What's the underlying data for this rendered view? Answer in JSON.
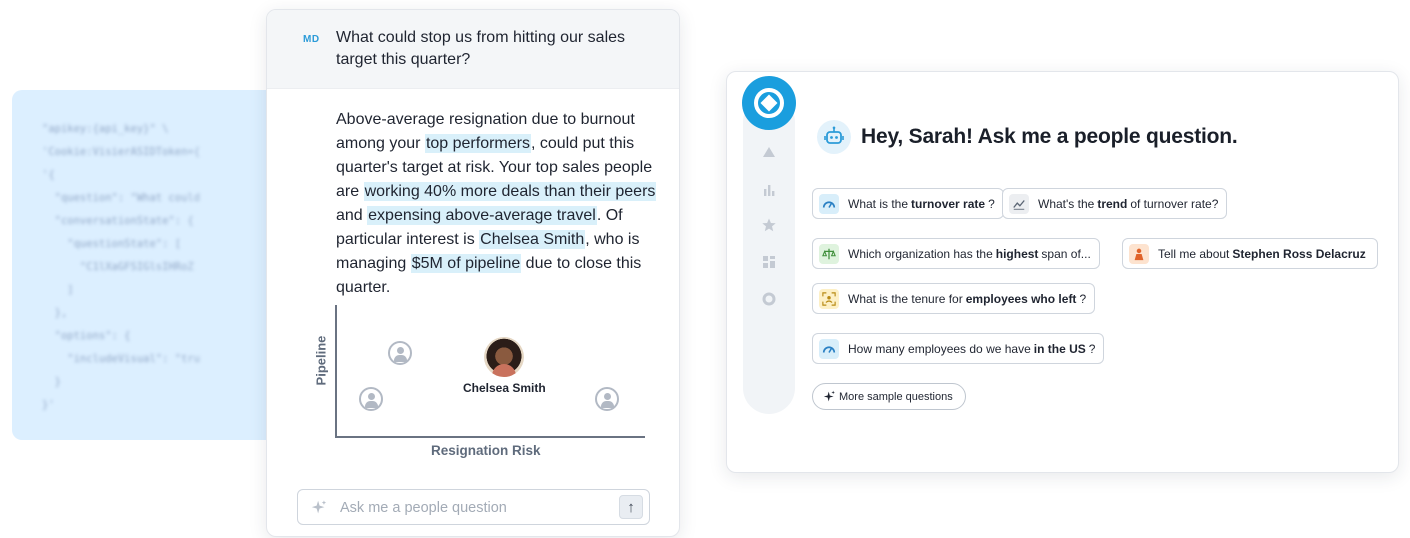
{
  "code_snippet": {
    "lines": [
      "\"apikey:{api_key}\" \\",
      "'Cookie:VisierASIDToken={",
      "'{",
      "  \"question\": \"What could",
      "  \"conversationState\": {",
      "    \"questionState\": [",
      "      \"C1lXaGFSIGlsIHRoZ",
      "    ]",
      "  },",
      "  \"options\": {",
      "    \"includeVisual\": \"tru",
      "  }",
      "}'"
    ]
  },
  "chat": {
    "user_initials": "MD",
    "question": "What could stop us from hitting our sales target this quarter?",
    "answer": {
      "p1": "Above-average resignation due to burnout among your ",
      "h1": "top performers",
      "p2": ", could put this quarter's target at risk. Your top sales people are ",
      "h2": "working 40% more deals than their peers",
      "p3": " and ",
      "h3": "expensing above-average travel",
      "p4": ". Of particular interest is ",
      "h4": "Chelsea Smith",
      "p5": ", who is managing ",
      "h5": "$5M of pipeline",
      "p6": " due to close this quarter."
    },
    "input_placeholder": "Ask me a people question",
    "send_label": "↑"
  },
  "chart_data": {
    "type": "scatter",
    "xlabel": "Resignation Risk",
    "ylabel": "Pipeline",
    "points": [
      {
        "label": "",
        "risk": "low",
        "pipeline": "high"
      },
      {
        "label": "",
        "risk": "low",
        "pipeline": "low"
      },
      {
        "label": "Chelsea Smith",
        "risk": "medium",
        "pipeline": "high",
        "photo": true
      },
      {
        "label": "",
        "risk": "high",
        "pipeline": "low"
      }
    ]
  },
  "assistant": {
    "greeting": "Hey, Sarah! Ask me a people question.",
    "rail_icons": [
      "triangle-icon",
      "bar-chart-icon",
      "star-icon",
      "dashboard-icon",
      "circle-icon"
    ],
    "chips": [
      {
        "pre": "What is the",
        "bold": "turnover rate",
        "post": "?",
        "icon": "gauge-icon",
        "color": "#d8eefa"
      },
      {
        "pre": "What's the",
        "bold": "trend",
        "post": "of turnover rate?",
        "icon": "trend-icon",
        "color": "#eceef1"
      },
      {
        "pre": "Which organization has the",
        "bold": "highest",
        "post": "span of...",
        "icon": "scale-icon",
        "color": "#dff3de"
      },
      {
        "pre": "Tell me about",
        "bold": "Stephen Ross Delacruz",
        "post": "",
        "icon": "person-icon",
        "color": "#fde3cf"
      },
      {
        "pre": "What is the tenure for",
        "bold": "employees who left",
        "post": "?",
        "icon": "focus-person-icon",
        "color": "#fdf0c6"
      },
      {
        "pre": "How many employees do we have",
        "bold": "in the US",
        "post": "?",
        "icon": "gauge-icon",
        "color": "#d8eefa"
      }
    ],
    "more_label": "More sample questions"
  },
  "colors": {
    "accent": "#1a9ede",
    "highlight": "#d9f0fa",
    "code_bg": "#dcefff"
  }
}
